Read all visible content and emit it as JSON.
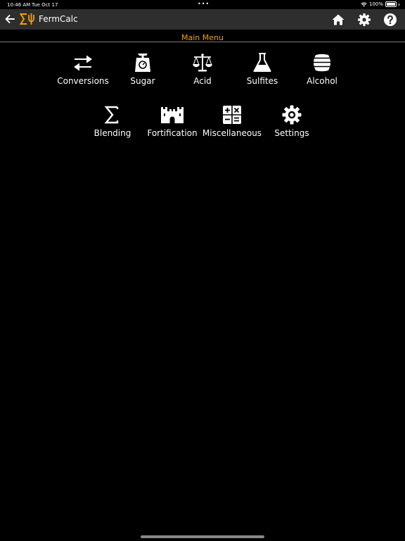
{
  "status_bar": {
    "time": "10:46 AM",
    "date": "Tue Oct 17",
    "dots": "•••",
    "battery": "100%"
  },
  "navbar": {
    "app_title": "FermCalc"
  },
  "header": {
    "title": "Main Menu"
  },
  "menu": {
    "items": [
      {
        "label": "Conversions",
        "icon": "arrows-exchange-icon"
      },
      {
        "label": "Sugar",
        "icon": "kitchen-scale-icon"
      },
      {
        "label": "Acid",
        "icon": "balance-scale-icon"
      },
      {
        "label": "Sulfites",
        "icon": "flask-icon"
      },
      {
        "label": "Alcohol",
        "icon": "barrel-icon"
      },
      {
        "label": "Blending",
        "icon": "sigma-icon"
      },
      {
        "label": "Fortification",
        "icon": "castle-icon"
      },
      {
        "label": "Miscellaneous",
        "icon": "calculator-icon"
      },
      {
        "label": "Settings",
        "icon": "gear-icon"
      }
    ]
  },
  "colors": {
    "accent": "#f5a000",
    "navbar": "#2e2e2e",
    "background": "#000000"
  }
}
